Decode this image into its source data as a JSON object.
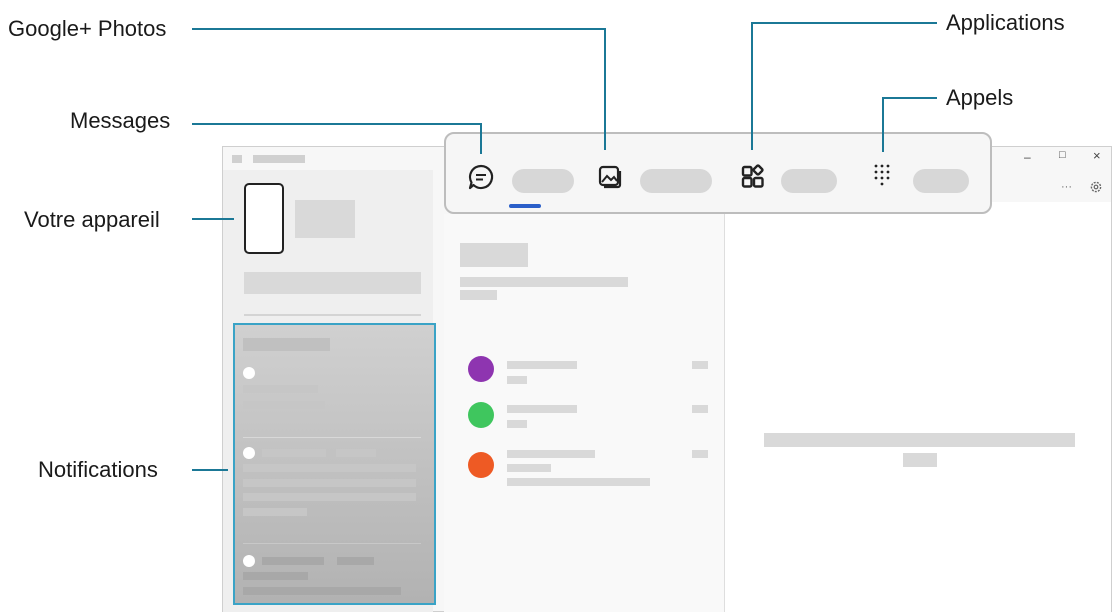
{
  "callouts": {
    "google_photos": "Google+ Photos",
    "applications": "Applications",
    "messages": "Messages",
    "appels": "Appels",
    "votre_appareil": "Votre appareil",
    "notifications": "Notifications"
  },
  "window_controls": {
    "minimize": "–",
    "maximize": "□",
    "close": "×",
    "more": "···"
  },
  "colors": {
    "leader": "#1b7896",
    "highlight_border": "#3aa3c6",
    "tab_indicator": "#2b5fc9",
    "contact_1": "#8e35b0",
    "contact_2": "#3fc65e",
    "contact_3": "#ee5a24"
  },
  "icons": {
    "messages": "chat-bubble-icon",
    "photos": "photo-icon",
    "applications": "apps-grid-icon",
    "appels": "dialpad-icon",
    "settings": "gear-icon"
  }
}
